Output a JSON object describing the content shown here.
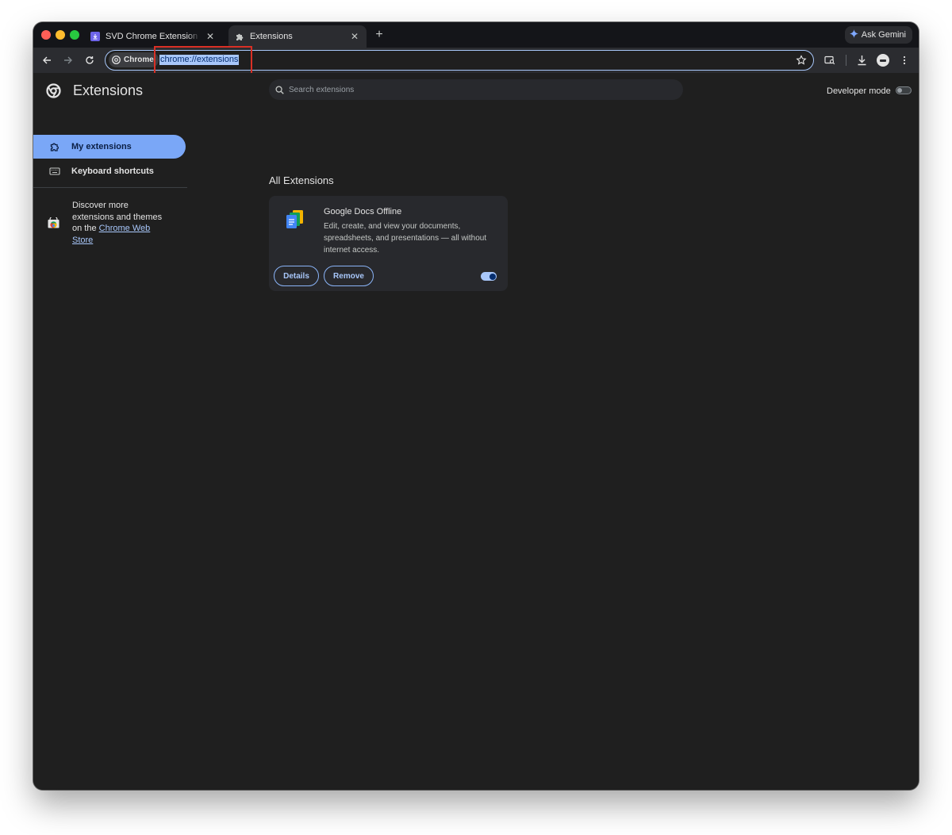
{
  "browser": {
    "tabs": [
      {
        "title": "SVD Chrome Extension — Onl",
        "icon": "download-icon"
      },
      {
        "title": "Extensions",
        "icon": "puzzle-icon"
      }
    ],
    "ask_gemini_label": "Ask Gemini",
    "omnibox": {
      "chip_label": "Chrome",
      "url": "chrome://extensions"
    }
  },
  "page": {
    "header_title": "Extensions",
    "search_placeholder": "Search extensions",
    "developer_mode_label": "Developer mode",
    "sidebar": {
      "items": [
        {
          "label": "My extensions",
          "icon": "puzzle-outline-icon"
        },
        {
          "label": "Keyboard shortcuts",
          "icon": "keyboard-icon"
        }
      ],
      "discover": {
        "prefix": "Discover more extensions and themes on the",
        "link": "Chrome Web Store"
      }
    },
    "section_title": "All Extensions",
    "extensions": [
      {
        "name": "Google Docs Offline",
        "description": "Edit, create, and view your documents, spreadsheets, and presentations — all without internet access.",
        "details_label": "Details",
        "remove_label": "Remove",
        "enabled": true
      }
    ]
  },
  "colors": {
    "accent": "#a8c7fa",
    "active_nav": "#7aa7f7",
    "highlight_box": "#d93025"
  }
}
